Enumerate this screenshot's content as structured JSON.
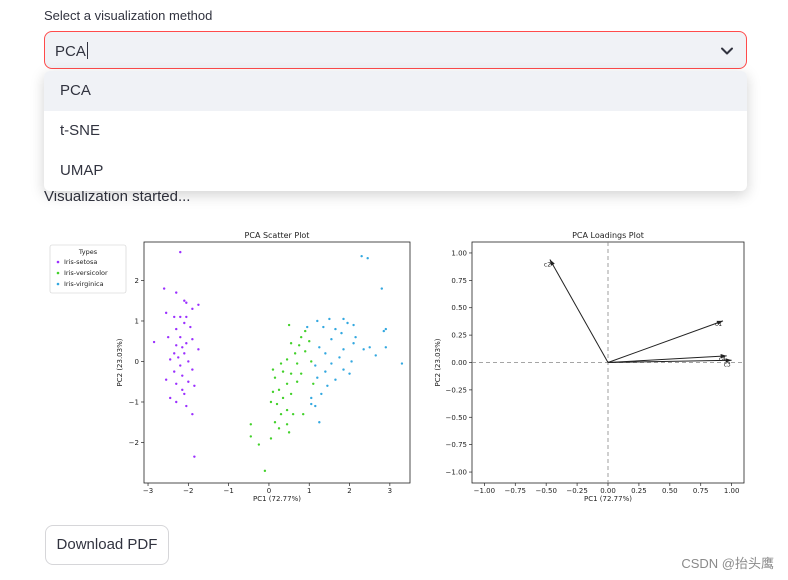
{
  "select": {
    "label": "Select a visualization method",
    "value": "PCA",
    "options": [
      "PCA",
      "t-SNE",
      "UMAP"
    ]
  },
  "status": "Visualization started...",
  "download_label": "Download PDF",
  "watermark": "CSDN @抬头鹰",
  "chart_data": [
    {
      "type": "scatter",
      "title": "PCA Scatter Plot",
      "xlabel": "PC1 (72.77%)",
      "ylabel": "PC2 (23.03%)",
      "xlim": [
        -3.1,
        3.5
      ],
      "ylim": [
        -3.0,
        2.95
      ],
      "xticks": [
        -3,
        -2,
        -1,
        0,
        1,
        2,
        3
      ],
      "yticks": [
        -2,
        -1,
        0,
        1,
        2
      ],
      "legend": {
        "title": "Types",
        "position": "top-left"
      },
      "series": [
        {
          "name": "Iris-setosa",
          "color": "#9b30ff",
          "points": [
            [
              -2.2,
              2.7
            ],
            [
              -2.3,
              1.7
            ],
            [
              -2.05,
              1.45
            ],
            [
              -2.6,
              1.8
            ],
            [
              -2.1,
              1.5
            ],
            [
              -1.9,
              1.3
            ],
            [
              -1.75,
              1.4
            ],
            [
              -2.55,
              1.2
            ],
            [
              -2.35,
              1.1
            ],
            [
              -2.2,
              1.1
            ],
            [
              -2.05,
              1.1
            ],
            [
              -2.1,
              0.95
            ],
            [
              -1.95,
              0.85
            ],
            [
              -2.3,
              0.8
            ],
            [
              -2.5,
              0.6
            ],
            [
              -2.2,
              0.6
            ],
            [
              -1.9,
              0.55
            ],
            [
              -2.05,
              0.45
            ],
            [
              -2.3,
              0.4
            ],
            [
              -2.15,
              0.35
            ],
            [
              -2.85,
              0.48
            ],
            [
              -1.75,
              0.3
            ],
            [
              -2.35,
              0.2
            ],
            [
              -2.1,
              0.2
            ],
            [
              -2.25,
              0.1
            ],
            [
              -2.0,
              0.0
            ],
            [
              -2.45,
              0.05
            ],
            [
              -2.2,
              -0.1
            ],
            [
              -1.9,
              -0.2
            ],
            [
              -2.35,
              -0.25
            ],
            [
              -2.15,
              -0.35
            ],
            [
              -2.55,
              -0.45
            ],
            [
              -2.0,
              -0.5
            ],
            [
              -2.3,
              -0.55
            ],
            [
              -1.85,
              -0.6
            ],
            [
              -2.15,
              -0.7
            ],
            [
              -2.45,
              -0.9
            ],
            [
              -2.1,
              -0.8
            ],
            [
              -2.3,
              -1.0
            ],
            [
              -2.05,
              -1.1
            ],
            [
              -1.9,
              -1.3
            ],
            [
              -1.85,
              -2.35
            ]
          ]
        },
        {
          "name": "Iris-versicolor",
          "color": "#43d12b",
          "points": [
            [
              0.5,
              0.9
            ],
            [
              0.9,
              0.75
            ],
            [
              0.8,
              0.6
            ],
            [
              1.0,
              0.5
            ],
            [
              0.75,
              0.4
            ],
            [
              0.55,
              0.45
            ],
            [
              0.9,
              0.25
            ],
            [
              0.65,
              0.2
            ],
            [
              0.45,
              0.05
            ],
            [
              0.7,
              -0.05
            ],
            [
              1.05,
              0.0
            ],
            [
              0.3,
              -0.05
            ],
            [
              0.1,
              -0.2
            ],
            [
              0.35,
              -0.25
            ],
            [
              0.55,
              -0.3
            ],
            [
              0.8,
              -0.3
            ],
            [
              0.15,
              -0.4
            ],
            [
              0.45,
              -0.55
            ],
            [
              0.7,
              -0.5
            ],
            [
              1.1,
              -0.55
            ],
            [
              0.25,
              -0.7
            ],
            [
              0.1,
              -0.75
            ],
            [
              0.55,
              -0.8
            ],
            [
              0.35,
              -0.9
            ],
            [
              0.05,
              -1.0
            ],
            [
              0.2,
              -1.05
            ],
            [
              0.45,
              -1.2
            ],
            [
              0.3,
              -1.3
            ],
            [
              0.6,
              -1.3
            ],
            [
              0.85,
              -1.3
            ],
            [
              0.15,
              -1.5
            ],
            [
              0.45,
              -1.55
            ],
            [
              -0.45,
              -1.55
            ],
            [
              0.25,
              -1.65
            ],
            [
              0.5,
              -1.75
            ],
            [
              -0.45,
              -1.85
            ],
            [
              0.05,
              -1.9
            ],
            [
              -0.25,
              -2.05
            ],
            [
              -0.1,
              -2.7
            ]
          ]
        },
        {
          "name": "Iris-virginica",
          "color": "#33a8e0",
          "points": [
            [
              2.3,
              2.6
            ],
            [
              2.45,
              2.55
            ],
            [
              2.8,
              1.8
            ],
            [
              2.9,
              0.8
            ],
            [
              2.85,
              0.75
            ],
            [
              1.85,
              1.05
            ],
            [
              1.95,
              0.95
            ],
            [
              1.5,
              1.05
            ],
            [
              1.2,
              1.0
            ],
            [
              2.1,
              0.9
            ],
            [
              1.65,
              0.8
            ],
            [
              1.35,
              0.85
            ],
            [
              0.95,
              0.85
            ],
            [
              1.8,
              0.7
            ],
            [
              2.15,
              0.6
            ],
            [
              1.55,
              0.55
            ],
            [
              2.1,
              0.45
            ],
            [
              2.35,
              0.3
            ],
            [
              1.85,
              0.3
            ],
            [
              1.25,
              0.35
            ],
            [
              2.5,
              0.35
            ],
            [
              2.9,
              0.35
            ],
            [
              1.4,
              0.2
            ],
            [
              2.65,
              0.15
            ],
            [
              1.75,
              0.1
            ],
            [
              3.3,
              -0.05
            ],
            [
              2.05,
              0.0
            ],
            [
              1.55,
              -0.05
            ],
            [
              1.15,
              -0.1
            ],
            [
              1.85,
              -0.2
            ],
            [
              1.4,
              -0.25
            ],
            [
              2.0,
              -0.3
            ],
            [
              1.2,
              -0.4
            ],
            [
              1.65,
              -0.45
            ],
            [
              1.45,
              -0.6
            ],
            [
              1.3,
              -0.8
            ],
            [
              1.05,
              -0.9
            ],
            [
              1.15,
              -1.1
            ],
            [
              1.25,
              -1.5
            ],
            [
              1.05,
              -1.05
            ]
          ]
        }
      ]
    },
    {
      "type": "scatter",
      "title": "PCA Loadings Plot",
      "xlabel": "PC1 (72.77%)",
      "ylabel": "PC2 (23.03%)",
      "xlim": [
        -1.1,
        1.1
      ],
      "ylim": [
        -1.1,
        1.1
      ],
      "xticks": [
        "-1.00",
        "-0.75",
        "-0.50",
        "-0.25",
        "0.00",
        "0.25",
        "0.50",
        "0.75",
        "1.00"
      ],
      "yticks": [
        "1.00",
        "0.75",
        "0.50",
        "0.25",
        "0.00",
        "-0.25",
        "-0.50",
        "-0.75",
        "-1.00"
      ],
      "vectors": [
        {
          "name": "c1",
          "x": 0.93,
          "y": 0.38
        },
        {
          "name": "c2",
          "x": -0.47,
          "y": 0.94
        },
        {
          "name": "c3",
          "x": 1.0,
          "y": 0.02
        },
        {
          "name": "c4",
          "x": 0.96,
          "y": 0.06
        }
      ]
    }
  ]
}
